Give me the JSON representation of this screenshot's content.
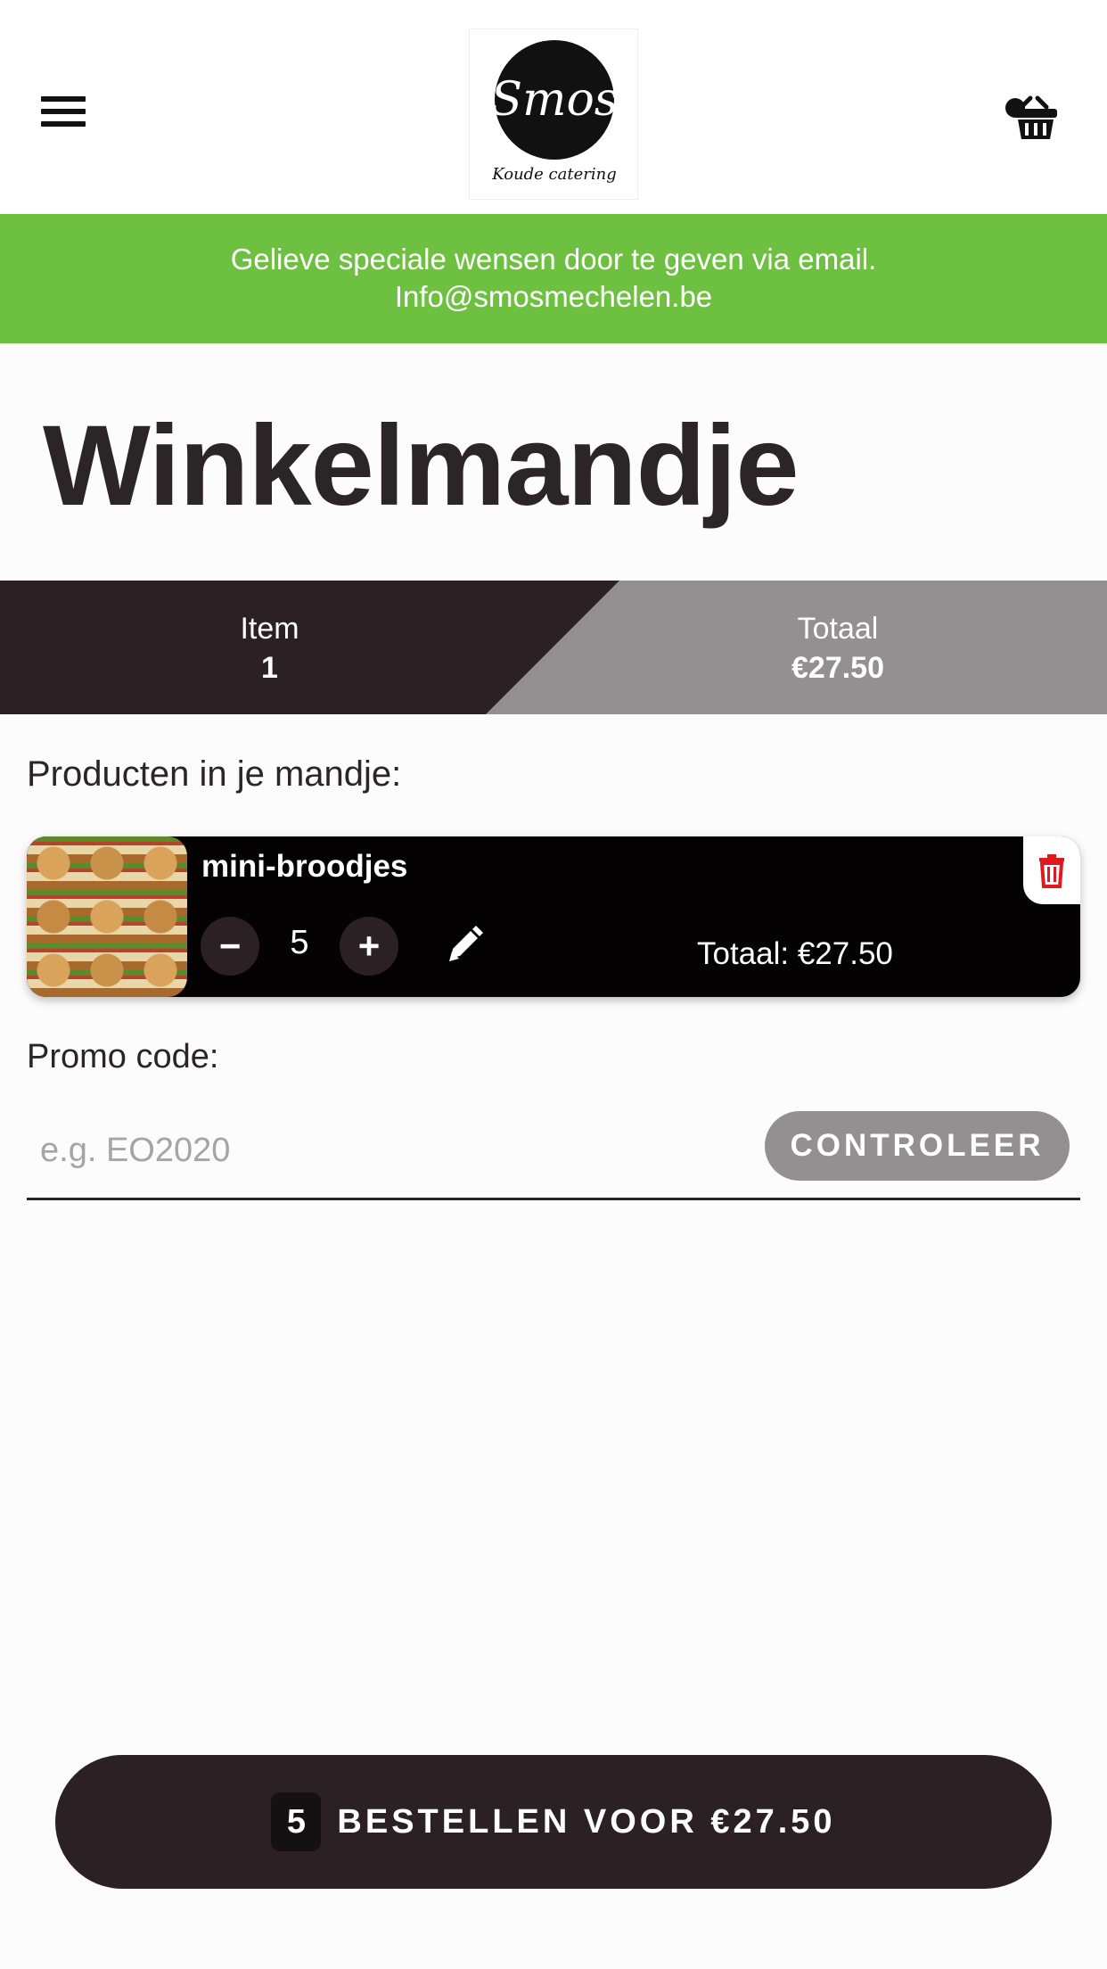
{
  "header": {
    "menu_icon": "hamburger-menu-icon",
    "logo": {
      "name": "Smos",
      "tagline": "Koude catering"
    },
    "cart_icon": "shopping-basket-icon"
  },
  "banner": {
    "line1": "Gelieve speciale wensen door te geven via email.",
    "line2": "Info@smosmechelen.be",
    "color": "#6ec140"
  },
  "page": {
    "title": "Winkelmandje"
  },
  "summary": {
    "item_label": "Item",
    "item_value": "1",
    "total_label": "Totaal",
    "total_value": "€27.50"
  },
  "cart": {
    "heading": "Producten in je mandje:",
    "items": [
      {
        "name": "mini-broodjes",
        "quantity": "5",
        "decrease_label": "−",
        "increase_label": "+",
        "total": "Totaal: €27.50",
        "edit_icon": "pencil-icon",
        "delete_icon": "trash-icon"
      }
    ]
  },
  "promo": {
    "label": "Promo code:",
    "placeholder": "e.g. EO2020",
    "value": "",
    "button_label": "CONTROLEER"
  },
  "order": {
    "count": "5",
    "label": "BESTELLEN VOOR €27.50"
  },
  "colors": {
    "dark": "#2b2024",
    "grey": "#948f91",
    "accent_green": "#6ec140",
    "delete_red": "#e0191f"
  }
}
